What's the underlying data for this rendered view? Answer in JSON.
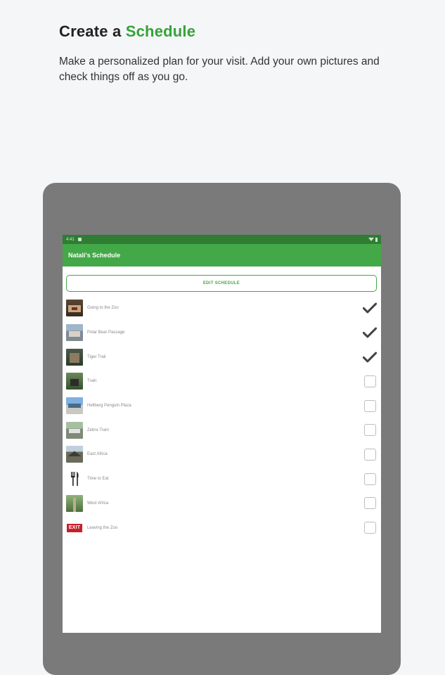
{
  "header": {
    "title_prefix": "Create a",
    "title_accent": "Schedule",
    "subtitle": "Make a personalized plan for your visit. Add your own pictures and check things off as you go."
  },
  "device": {
    "statusbar": {
      "time": "4:41"
    },
    "appbar": {
      "title": "Natali's Schedule"
    },
    "edit_button": {
      "label": "EDIT SCHEDULE"
    },
    "schedule": [
      {
        "label": "Going to the Zoo",
        "checked": true,
        "icon": "zoo-entrance-photo"
      },
      {
        "label": "Polar Bear Passage",
        "checked": true,
        "icon": "polar-bear-photo"
      },
      {
        "label": "Tiger Trail",
        "checked": true,
        "icon": "tiger-trail-photo"
      },
      {
        "label": "Train",
        "checked": false,
        "icon": "train-photo"
      },
      {
        "label": "Hellberg Penguin Plaza",
        "checked": false,
        "icon": "penguin-plaza-photo"
      },
      {
        "label": "Zebra Tram",
        "checked": false,
        "icon": "zebra-tram-photo"
      },
      {
        "label": "East Africa",
        "checked": false,
        "icon": "east-africa-photo"
      },
      {
        "label": "Time to Eat",
        "checked": false,
        "icon": "fork-knife-icon"
      },
      {
        "label": "West Africa",
        "checked": false,
        "icon": "west-africa-photo"
      },
      {
        "label": "Leaving the Zoo",
        "checked": false,
        "icon": "exit-sign-icon",
        "icon_text": "EXIT"
      }
    ]
  },
  "colors": {
    "accent": "#36a23a",
    "appbar": "#43a847",
    "statusbar": "#2f7d32",
    "device_frame": "#7a7a7a"
  }
}
